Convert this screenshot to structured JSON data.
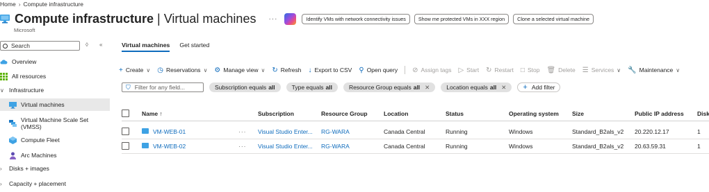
{
  "breadcrumb": {
    "home": "Home",
    "current": "Compute infrastructure"
  },
  "header": {
    "title_bold": "Compute infrastructure",
    "title_light": "| Virtual machines",
    "subtitle": "Microsoft",
    "more": "···",
    "suggestions": [
      "Identify VMs with network connectivity issues",
      "Show me protected VMs in XXX region",
      "Clone a selected virtual machine"
    ]
  },
  "sidebar": {
    "search_placeholder": "Search",
    "items": [
      {
        "label": "Overview",
        "icon": "cloud-icon"
      },
      {
        "label": "All resources",
        "icon": "grid-icon"
      },
      {
        "label": "Infrastructure",
        "icon": "chevron-down-icon"
      },
      {
        "label": "Virtual machines",
        "icon": "monitor-icon"
      },
      {
        "label": "Virtual Machine Scale Set",
        "label2": "(VMSS)",
        "icon": "scale-set-icon"
      },
      {
        "label": "Compute Fleet",
        "icon": "fleet-icon"
      },
      {
        "label": "Arc Machines",
        "icon": "arc-icon"
      },
      {
        "label": "Disks + images",
        "icon": "chevron-right-icon"
      },
      {
        "label": "Capacity + placement",
        "icon": "chevron-right-icon"
      }
    ]
  },
  "tabs": [
    "Virtual machines",
    "Get started"
  ],
  "toolbar": {
    "create": "Create",
    "reservations": "Reservations",
    "manage_view": "Manage view",
    "refresh": "Refresh",
    "export": "Export to CSV",
    "open_query": "Open query",
    "assign_tags": "Assign tags",
    "start": "Start",
    "restart": "Restart",
    "stop": "Stop",
    "delete": "Delete",
    "services": "Services",
    "maintenance": "Maintenance"
  },
  "filters": {
    "placeholder": "Filter for any field...",
    "pills": [
      {
        "name": "Subscription equals",
        "value": "all"
      },
      {
        "name": "Type equals",
        "value": "all"
      },
      {
        "name": "Resource Group equals",
        "value": "all"
      },
      {
        "name": "Location equals",
        "value": "all"
      }
    ],
    "add_filter": "Add filter"
  },
  "table": {
    "columns": [
      "Name ↑",
      "Subscription",
      "Resource Group",
      "Location",
      "Status",
      "Operating system",
      "Size",
      "Public IP address",
      "Disk"
    ],
    "rows": [
      {
        "name": "VM-WEB-01",
        "subscription": "Visual Studio Enter...",
        "resource_group": "RG-WARA",
        "location": "Canada Central",
        "status": "Running",
        "os": "Windows",
        "size": "Standard_B2als_v2",
        "ip": "20.220.12.17",
        "disks": "1"
      },
      {
        "name": "VM-WEB-02",
        "subscription": "Visual Studio Enter...",
        "resource_group": "RG-WARA",
        "location": "Canada Central",
        "status": "Running",
        "os": "Windows",
        "size": "Standard_B2als_v2",
        "ip": "20.63.59.31",
        "disks": "1"
      }
    ]
  },
  "colors": {
    "accent": "#0f6cbd",
    "selected_bg": "#e8e8e8"
  }
}
